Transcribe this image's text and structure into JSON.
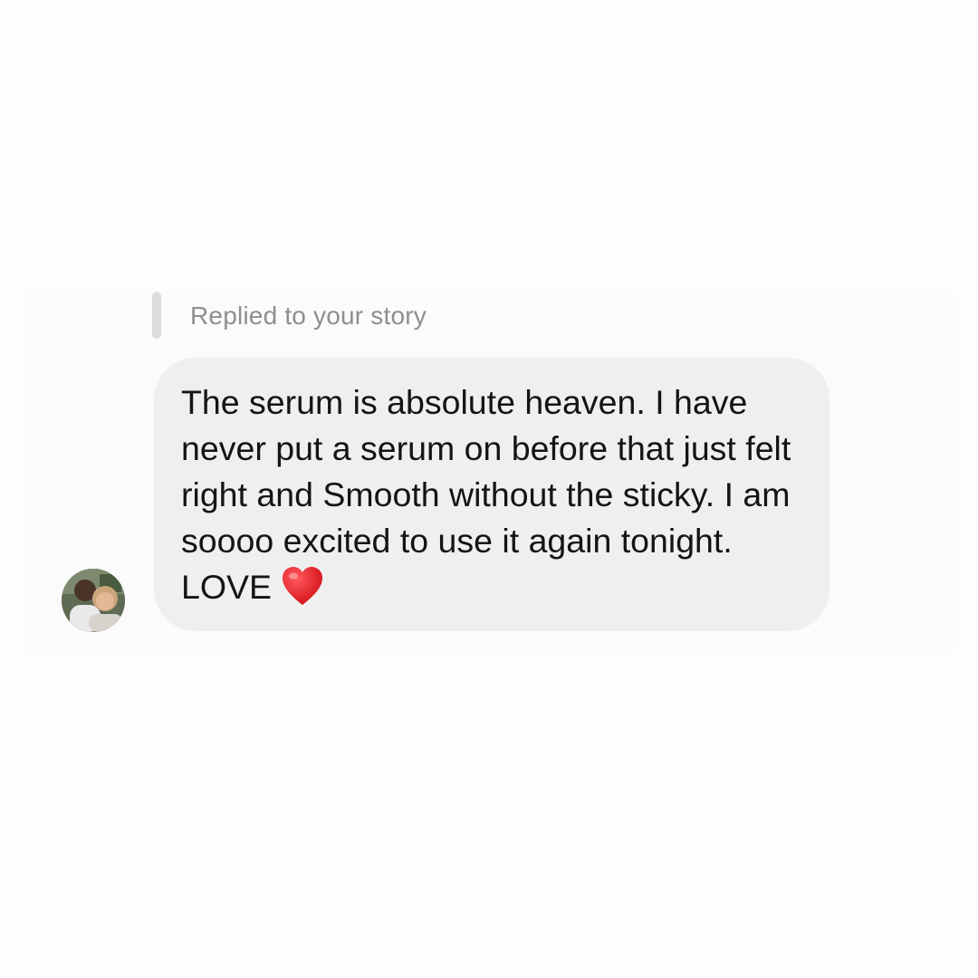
{
  "message": {
    "reply_context": "Replied to your story",
    "text": "The serum is absolute heaven. I have never put a serum on before that just felt right and Smooth without the sticky. I am soooo excited to use it again tonight. LOVE",
    "emoji": "red-heart-icon"
  },
  "sender": {
    "avatar_icon": "avatar-photo"
  },
  "colors": {
    "bubble": "#efefef",
    "reply_label": "#8e8e8e",
    "reply_bar": "#dddddd",
    "text": "#141414",
    "heart": "#e0161e"
  }
}
